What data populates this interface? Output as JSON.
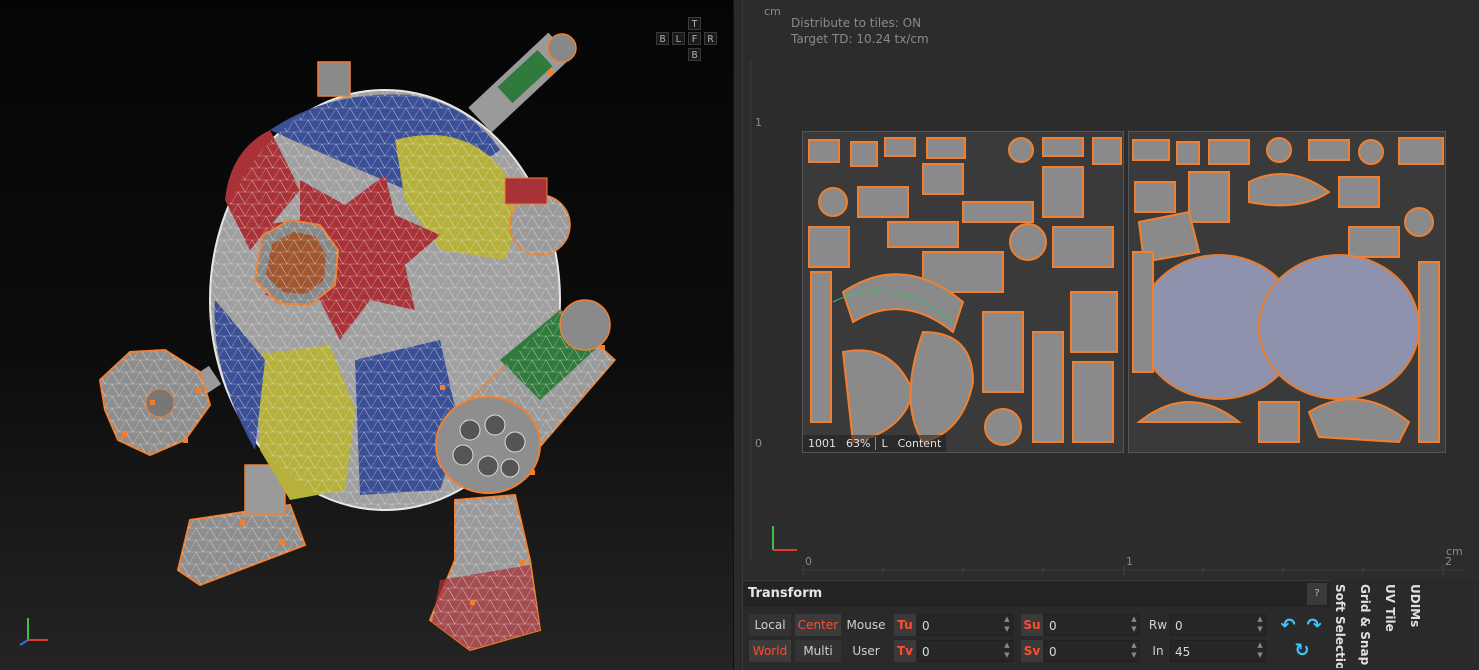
{
  "viewport3d": {
    "nav_cube": {
      "top": "T",
      "bottom": "B",
      "left": "B",
      "left2": "L",
      "front": "F",
      "right": "R"
    }
  },
  "uv_editor": {
    "unit_label_top": "cm",
    "unit_label_right": "cm",
    "info": {
      "distribute": "Distribute to tiles: ON",
      "target_td": "Target TD: 10.24 tx/cm"
    },
    "v_axis": [
      "1",
      "0"
    ],
    "u_axis": [
      "0",
      "1",
      "2"
    ],
    "tile_status": {
      "tile": "1001",
      "zoom": "63%",
      "mode": "L",
      "mode_text": "Content"
    }
  },
  "transform_panel": {
    "title": "Transform",
    "help": "?",
    "space_buttons": {
      "local": "Local",
      "world": "World",
      "center": "Center",
      "multi": "Multi",
      "mouse": "Mouse",
      "user": "User"
    },
    "fields": {
      "tu": {
        "label": "Tu",
        "value": "0"
      },
      "tv": {
        "label": "Tv",
        "value": "0"
      },
      "su": {
        "label": "Su",
        "value": "0"
      },
      "sv": {
        "label": "Sv",
        "value": "0"
      },
      "rw": {
        "label": "Rw",
        "value": "0"
      },
      "in": {
        "label": "In",
        "value": "45"
      }
    }
  },
  "side_tabs": [
    "Soft Selectio",
    "Grid & Snap",
    "UV Tile",
    "UDIMs"
  ],
  "colors": {
    "accent_orange": "#f08030",
    "active_red": "#ff4d2e",
    "rotate_cyan": "#3fc6ff",
    "patch_blue": "#3a4f96",
    "patch_red": "#a83238",
    "patch_yellow": "#b5b13a",
    "patch_green": "#2f7a3c"
  }
}
